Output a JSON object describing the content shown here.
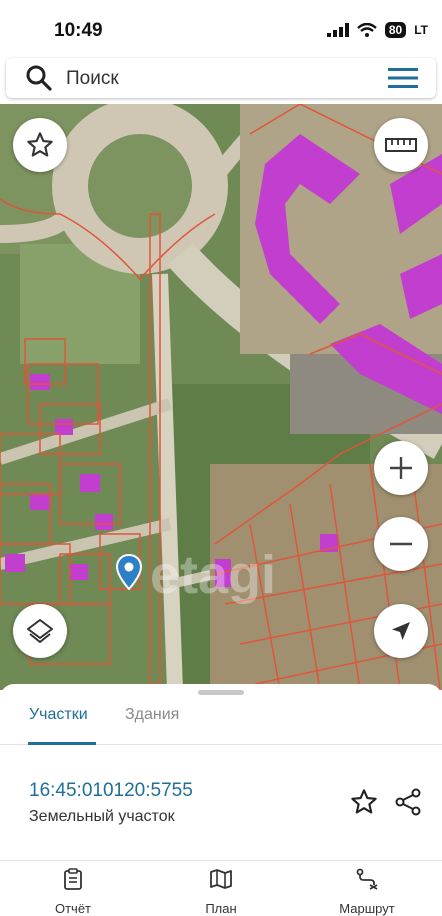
{
  "status_bar": {
    "time": "10:49",
    "battery": "80",
    "carrier": "LT"
  },
  "search": {
    "placeholder": "Поиск",
    "icon": "search-icon",
    "menu_icon": "hamburger-menu-icon"
  },
  "map": {
    "watermark": "etagi",
    "controls": {
      "favorite": "star-icon",
      "ruler": "ruler-icon",
      "zoom_in": "+",
      "zoom_out": "−",
      "layers": "layers-icon",
      "locate": "navigation-arrow-icon"
    },
    "marker": "location-pin-icon"
  },
  "sheet": {
    "tabs": [
      {
        "label": "Участки",
        "active": true
      },
      {
        "label": "Здания",
        "active": false
      }
    ],
    "parcel": {
      "cadastral_number": "16:45:010120:5755",
      "type": "Земельный участок"
    }
  },
  "navbar": {
    "items": [
      {
        "label": "Отчёт",
        "icon": "clipboard-icon"
      },
      {
        "label": "План",
        "icon": "map-icon"
      },
      {
        "label": "Маршрут",
        "icon": "route-icon"
      }
    ]
  },
  "colors": {
    "accent": "#1f6f9a",
    "parcel_border": "#e0553a",
    "building": "#c23ecf"
  }
}
